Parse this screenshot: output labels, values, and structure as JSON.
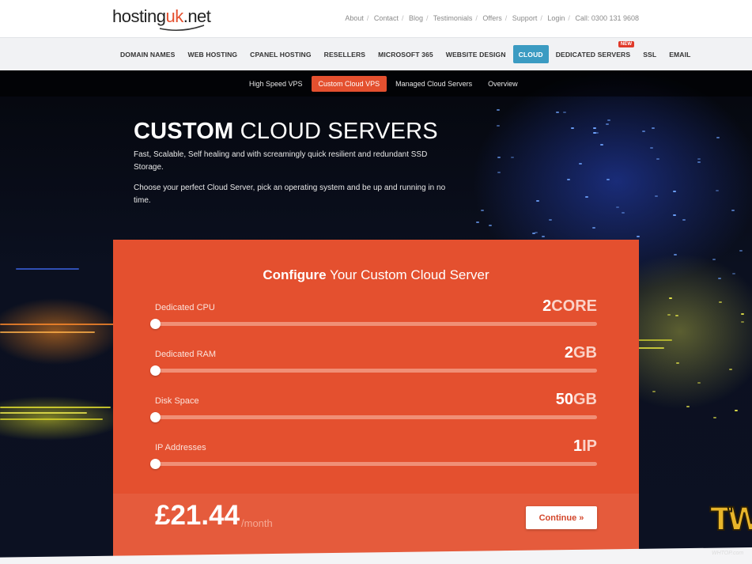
{
  "header": {
    "logo_main": "hosting",
    "logo_accent": "uk",
    "logo_tail": ".net",
    "links": [
      "About",
      "Contact",
      "Blog",
      "Testimonials",
      "Offers",
      "Support",
      "Login"
    ],
    "call": "Call: 0300 131 9608"
  },
  "mainnav": {
    "items": [
      "DOMAIN NAMES",
      "WEB HOSTING",
      "CPANEL HOSTING",
      "RESELLERS",
      "MICROSOFT 365",
      "WEBSITE DESIGN",
      "CLOUD",
      "DEDICATED SERVERS",
      "SSL",
      "EMAIL"
    ],
    "active": "CLOUD",
    "new_badge": "NEW"
  },
  "subnav": {
    "items": [
      "High Speed VPS",
      "Custom Cloud VPS",
      "Managed Cloud Servers",
      "Overview"
    ],
    "active": "Custom Cloud VPS"
  },
  "hero": {
    "title_bold": "CUSTOM",
    "title_rest": " CLOUD SERVERS",
    "para1": "Fast, Scalable, Self healing and with screamingly quick resilient and redundant SSD Storage.",
    "para2": "Choose your perfect Cloud Server, pick an operating system and be up and running in no time."
  },
  "configurator": {
    "title_bold": "Configure",
    "title_rest": " Your Custom Cloud Server",
    "sliders": [
      {
        "label": "Dedicated CPU",
        "value": "2",
        "unit": "CORE",
        "level": 0
      },
      {
        "label": "Dedicated RAM",
        "value": "2",
        "unit": "GB",
        "level": 0
      },
      {
        "label": "Disk Space",
        "value": "50",
        "unit": "GB",
        "level": 0
      },
      {
        "label": "IP Addresses",
        "value": "1",
        "unit": "IP",
        "level": 0
      }
    ],
    "price": "£21.44",
    "per": "/month",
    "continue_label": "Continue »"
  },
  "watermark": {
    "letters": "TW",
    "site": "WHTOP.com"
  },
  "colors": {
    "accent": "#e4502f",
    "nav_active": "#3b9bc2"
  }
}
